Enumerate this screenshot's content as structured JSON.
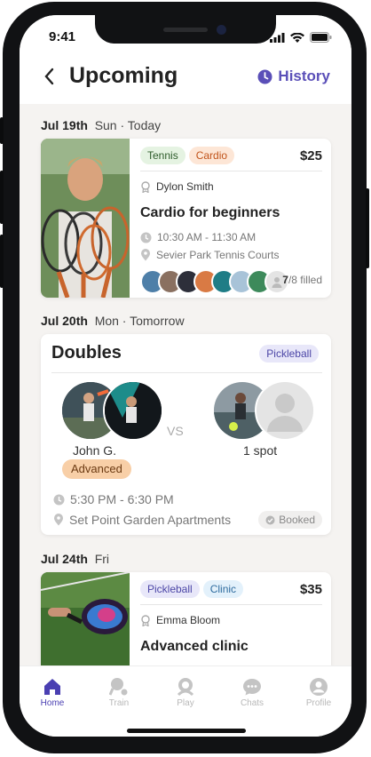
{
  "status_bar": {
    "time": "9:41"
  },
  "header": {
    "title": "Upcoming",
    "history_label": "History"
  },
  "days": [
    {
      "date": "Jul 19th",
      "day": "Sun · Today",
      "card": {
        "tags": [
          "Tennis",
          "Cardio"
        ],
        "price": "$25",
        "coach": "Dylon Smith",
        "title": "Cardio for beginners",
        "time": "10:30 AM - 11:30 AM",
        "location": "Sevier Park Tennis Courts",
        "filled_count": "7",
        "filled_total": "/8 filled"
      }
    },
    {
      "date": "Jul 20th",
      "day": "Mon · Tomorrow",
      "card": {
        "title": "Doubles",
        "tag": "Pickleball",
        "team_a_name": "John G.",
        "team_a_level": "Advanced",
        "vs": "VS",
        "team_b_label": "1 spot",
        "time": "5:30 PM - 6:30 PM",
        "location": "Set Point Garden Apartments",
        "status": "Booked"
      }
    },
    {
      "date": "Jul 24th",
      "day": "Fri",
      "card": {
        "tags": [
          "Pickleball",
          "Clinic"
        ],
        "price": "$35",
        "coach": "Emma Bloom",
        "title": "Advanced clinic"
      }
    }
  ],
  "tabbar": {
    "tabs": [
      {
        "label": "Home",
        "icon": "home-icon"
      },
      {
        "label": "Train",
        "icon": "train-icon"
      },
      {
        "label": "Play",
        "icon": "play-icon"
      },
      {
        "label": "Chats",
        "icon": "chat-icon"
      },
      {
        "label": "Profile",
        "icon": "profile-icon"
      }
    ]
  },
  "colors": {
    "accent": "#5a4fb8",
    "active_tab": "#4a3fb2",
    "cardio": "#c1541b",
    "advanced": "#f8cfa7"
  }
}
